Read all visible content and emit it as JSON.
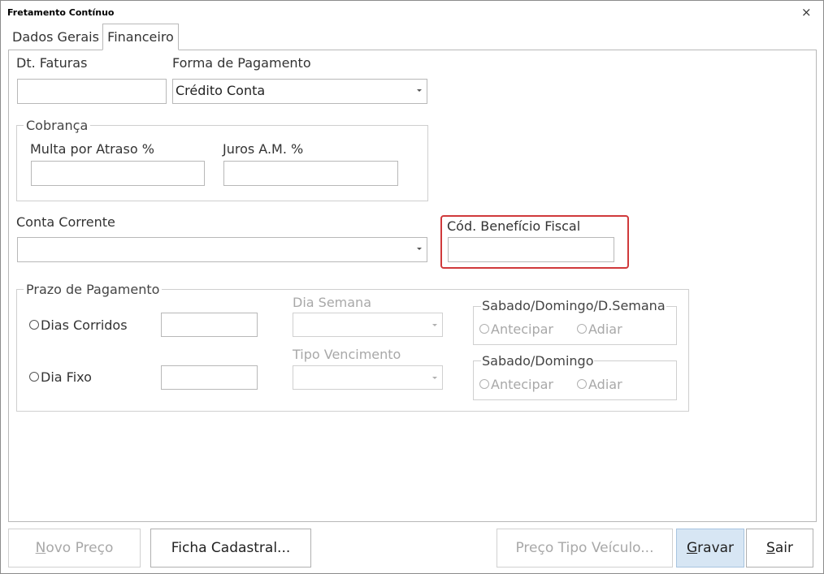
{
  "window": {
    "title": "Fretamento Contínuo",
    "close_glyph": "×"
  },
  "tabs": [
    {
      "label": "Dados Gerais",
      "active": false
    },
    {
      "label": "Financeiro",
      "active": true
    }
  ],
  "form": {
    "dt_faturas_label": "Dt. Faturas",
    "dt_faturas_value": "",
    "forma_pagamento_label": "Forma de Pagamento",
    "forma_pagamento_value": "Crédito Conta",
    "cobranca": {
      "legend": "Cobrança",
      "multa_label": "Multa por Atraso %",
      "multa_value": "",
      "juros_label": "Juros A.M. %",
      "juros_value": ""
    },
    "conta_corrente_label": "Conta Corrente",
    "conta_corrente_value": "",
    "cod_beneficio_label": "Cód. Benefício Fiscal",
    "cod_beneficio_value": "",
    "highlight_color": "#d0393b"
  },
  "prazo": {
    "legend": "Prazo de Pagamento",
    "dias_corridos_label": "Dias Corridos",
    "dia_fixo_label": "Dia Fixo",
    "dia_semana_label": "Dia Semana",
    "tipo_vencimento_label": "Tipo Vencimento",
    "sab_dom_dsemana": {
      "legend": "Sabado/Domingo/D.Semana",
      "antecipar": "Antecipar",
      "adiar": "Adiar"
    },
    "sab_dom": {
      "legend": "Sabado/Domingo",
      "antecipar": "Antecipar",
      "adiar": "Adiar"
    }
  },
  "buttons": {
    "novo_preco": {
      "mnemonic": "N",
      "rest": "ovo Preço",
      "enabled": false
    },
    "ficha_cadastral": {
      "label": "Ficha Cadastral...",
      "enabled": true
    },
    "preco_tipo_veiculo": {
      "label": "Preço Tipo Veículo...",
      "enabled": false
    },
    "gravar": {
      "mnemonic": "G",
      "rest": "ravar",
      "enabled": true
    },
    "sair": {
      "mnemonic": "S",
      "rest": "air",
      "enabled": true
    }
  }
}
